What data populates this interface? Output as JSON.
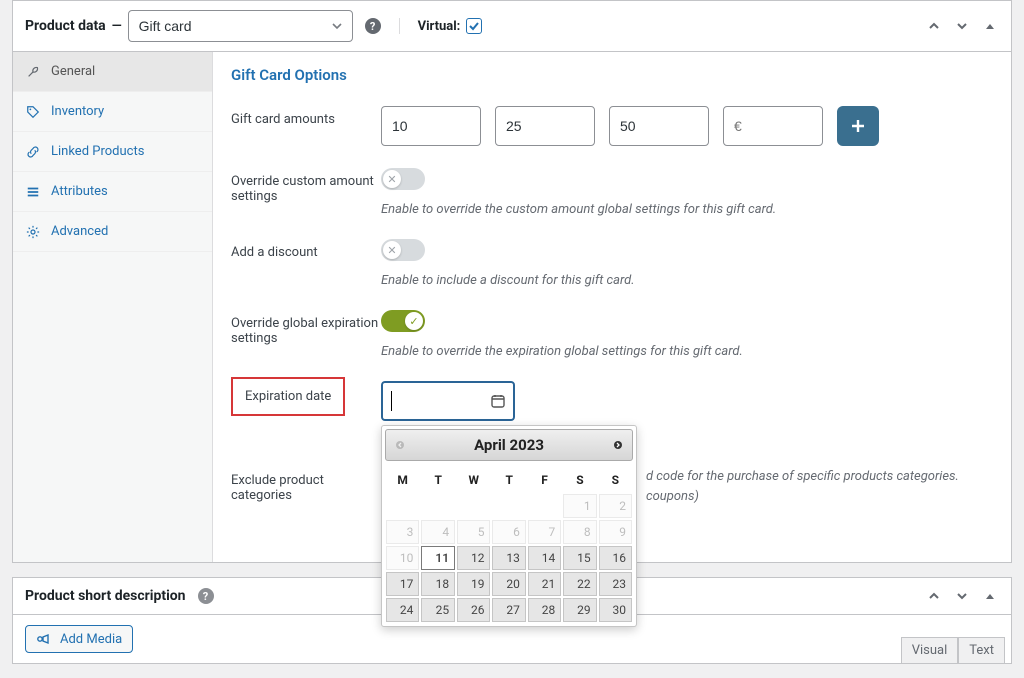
{
  "header": {
    "title": "Product data",
    "type_select": "Gift card",
    "virtual_label": "Virtual:",
    "virtual_checked": true
  },
  "tabs": [
    {
      "id": "general",
      "label": "General",
      "icon": "wrench-icon",
      "active": true
    },
    {
      "id": "inventory",
      "label": "Inventory",
      "icon": "tag-icon",
      "active": false
    },
    {
      "id": "linked",
      "label": "Linked Products",
      "icon": "link-icon",
      "active": false
    },
    {
      "id": "attributes",
      "label": "Attributes",
      "icon": "list-icon",
      "active": false
    },
    {
      "id": "advanced",
      "label": "Advanced",
      "icon": "gear-icon",
      "active": false
    }
  ],
  "section": {
    "title": "Gift Card Options",
    "amounts_label": "Gift card amounts",
    "amounts": [
      "10",
      "25",
      "50"
    ],
    "amount_currency_placeholder": "€",
    "override_custom_label": "Override custom amount settings",
    "override_custom_desc": "Enable to override the custom amount global settings for this gift card.",
    "add_discount_label": "Add a discount",
    "add_discount_desc": "Enable to include a discount for this gift card.",
    "override_exp_label": "Override global expiration settings",
    "override_exp_desc": "Enable to override the expiration global settings for this gift card.",
    "expiration_label": "Expiration date",
    "expiration_value": "",
    "exclude_label": "Exclude product categories",
    "exclude_desc_line1": "d code for the purchase of specific products categories.",
    "exclude_desc_line2": "coupons)"
  },
  "datepicker": {
    "month_title": "April 2023",
    "dow": [
      "M",
      "T",
      "W",
      "T",
      "F",
      "S",
      "S"
    ],
    "weeks": [
      [
        {
          "d": "",
          "t": "empty"
        },
        {
          "d": "",
          "t": "empty"
        },
        {
          "d": "",
          "t": "empty"
        },
        {
          "d": "",
          "t": "empty"
        },
        {
          "d": "",
          "t": "empty"
        },
        {
          "d": "1",
          "t": "disabled"
        },
        {
          "d": "2",
          "t": "disabled"
        }
      ],
      [
        {
          "d": "3",
          "t": "disabled"
        },
        {
          "d": "4",
          "t": "disabled"
        },
        {
          "d": "5",
          "t": "disabled"
        },
        {
          "d": "6",
          "t": "disabled"
        },
        {
          "d": "7",
          "t": "disabled"
        },
        {
          "d": "8",
          "t": "disabled"
        },
        {
          "d": "9",
          "t": "disabled"
        }
      ],
      [
        {
          "d": "10",
          "t": "disabled"
        },
        {
          "d": "11",
          "t": "today"
        },
        {
          "d": "12",
          "t": ""
        },
        {
          "d": "13",
          "t": ""
        },
        {
          "d": "14",
          "t": ""
        },
        {
          "d": "15",
          "t": ""
        },
        {
          "d": "16",
          "t": ""
        }
      ],
      [
        {
          "d": "17",
          "t": ""
        },
        {
          "d": "18",
          "t": ""
        },
        {
          "d": "19",
          "t": ""
        },
        {
          "d": "20",
          "t": ""
        },
        {
          "d": "21",
          "t": ""
        },
        {
          "d": "22",
          "t": ""
        },
        {
          "d": "23",
          "t": ""
        }
      ],
      [
        {
          "d": "24",
          "t": ""
        },
        {
          "d": "25",
          "t": ""
        },
        {
          "d": "26",
          "t": ""
        },
        {
          "d": "27",
          "t": ""
        },
        {
          "d": "28",
          "t": ""
        },
        {
          "d": "29",
          "t": ""
        },
        {
          "d": "30",
          "t": ""
        }
      ]
    ]
  },
  "short_desc": {
    "title": "Product short description",
    "add_media": "Add Media",
    "tab_visual": "Visual",
    "tab_text": "Text"
  }
}
